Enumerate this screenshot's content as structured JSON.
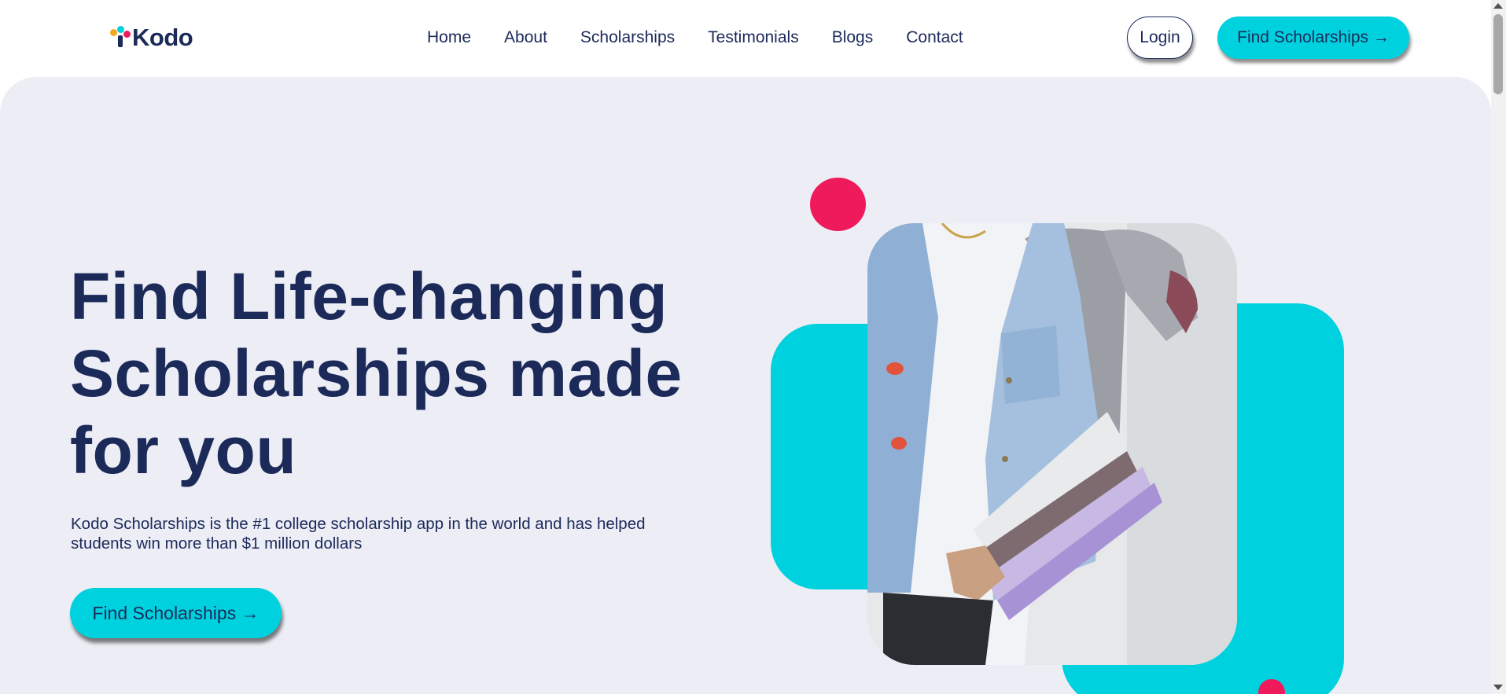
{
  "brand": {
    "name": "Kodo"
  },
  "nav": {
    "items": [
      {
        "label": "Home"
      },
      {
        "label": "About"
      },
      {
        "label": "Scholarships"
      },
      {
        "label": "Testimonials"
      },
      {
        "label": "Blogs"
      },
      {
        "label": "Contact"
      }
    ]
  },
  "header": {
    "login_label": "Login",
    "cta_label": "Find Scholarships →"
  },
  "hero": {
    "title_line1": "Find Life-changing",
    "title_line2": "Scholarships made",
    "title_line3": "for you",
    "description": "Kodo Scholarships is the #1 college scholarship app in the world and has helped students win more than $1 million dollars",
    "cta_label": "Find Scholarships →"
  },
  "colors": {
    "navy": "#1c2a5a",
    "teal": "#00d1de",
    "pink": "#ef1a5b",
    "orange": "#f5a623",
    "hero_bg": "#ecedf5"
  },
  "icons": [
    "kodo-logo-icon",
    "right-arrow-icon",
    "scroll-up-arrow-icon",
    "scroll-down-arrow-icon"
  ]
}
